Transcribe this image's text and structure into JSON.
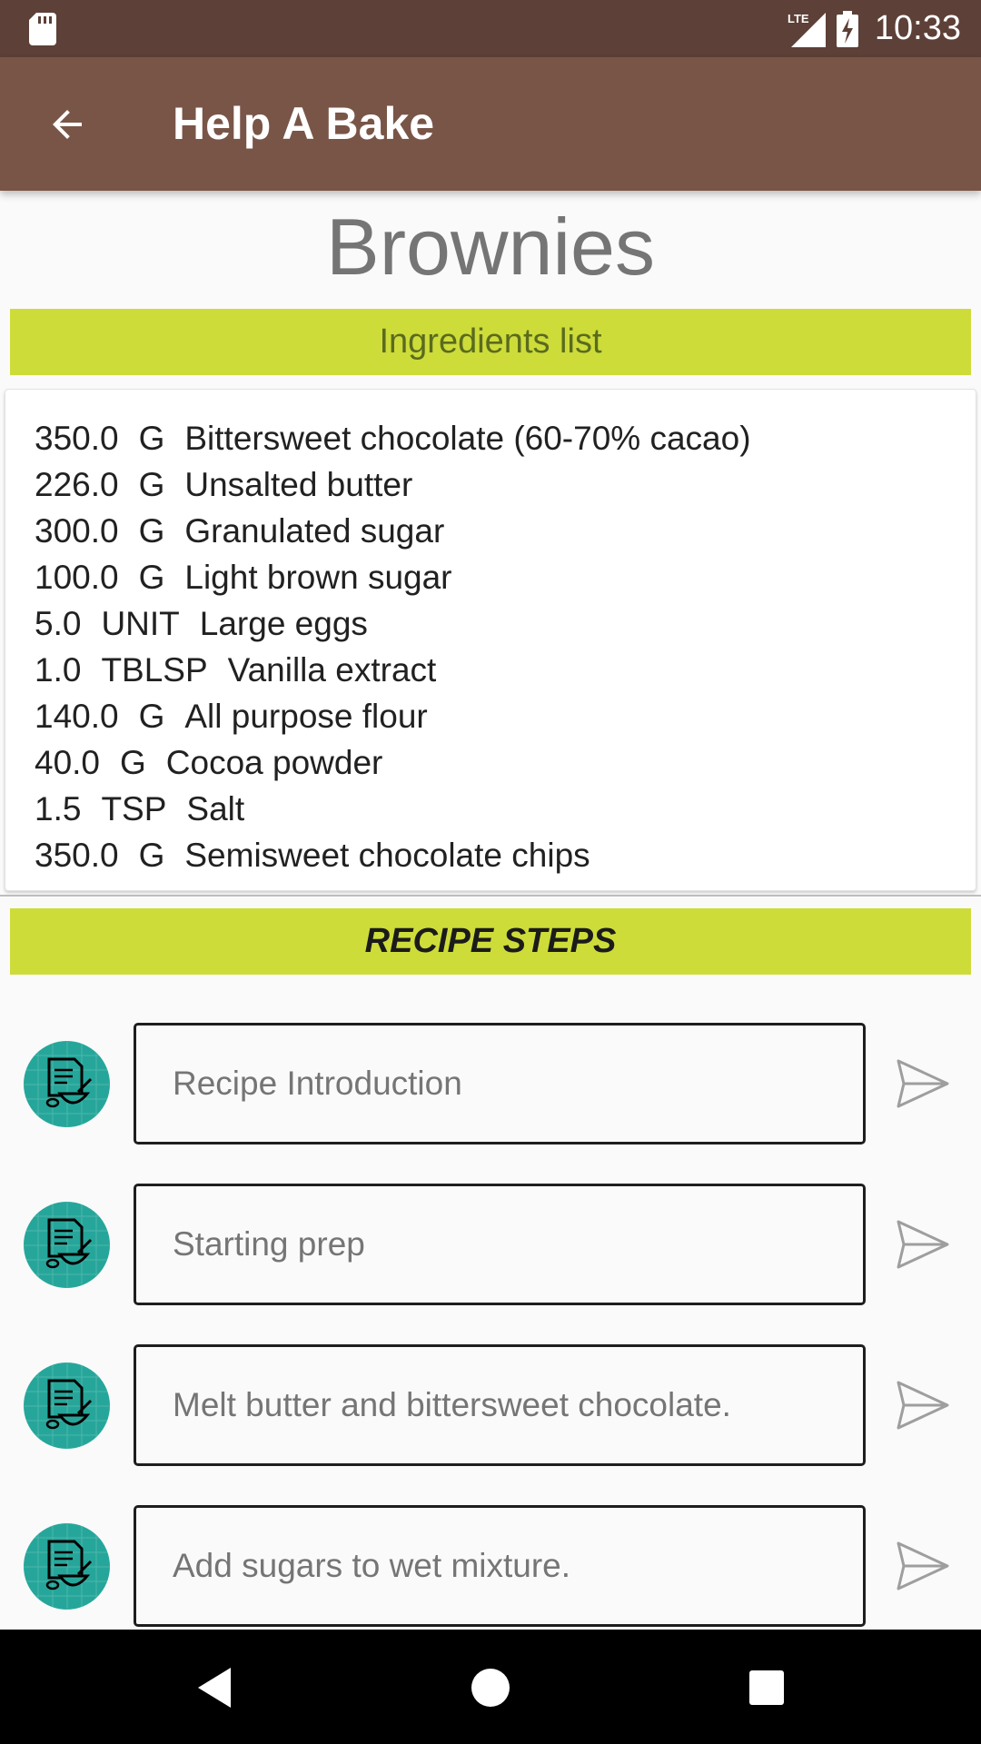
{
  "status_bar": {
    "time": "10:33",
    "network": "LTE",
    "icons": [
      "sd-card-icon",
      "signal-icon",
      "battery-charging-icon"
    ]
  },
  "app_bar": {
    "title": "Help A Bake",
    "back_icon": "arrow-back-icon"
  },
  "recipe": {
    "title": "Brownies",
    "ingredients_header": "Ingredients list",
    "steps_header": "RECIPE STEPS",
    "ingredients": [
      {
        "quantity": "350.0",
        "unit": "G",
        "name": "Bittersweet chocolate (60-70% cacao)"
      },
      {
        "quantity": "226.0",
        "unit": "G",
        "name": "Unsalted butter"
      },
      {
        "quantity": "300.0",
        "unit": "G",
        "name": "Granulated sugar"
      },
      {
        "quantity": "100.0",
        "unit": "G",
        "name": "Light brown sugar"
      },
      {
        "quantity": "5.0",
        "unit": "UNIT",
        "name": "Large eggs"
      },
      {
        "quantity": "1.0",
        "unit": "TBLSP",
        "name": "Vanilla extract"
      },
      {
        "quantity": "140.0",
        "unit": "G",
        "name": "All purpose flour"
      },
      {
        "quantity": "40.0",
        "unit": "G",
        "name": "Cocoa powder"
      },
      {
        "quantity": "1.5",
        "unit": "TSP",
        "name": "Salt"
      },
      {
        "quantity": "350.0",
        "unit": "G",
        "name": "Semisweet chocolate chips"
      }
    ],
    "steps": [
      {
        "label": "Recipe Introduction"
      },
      {
        "label": "Starting prep"
      },
      {
        "label": "Melt butter and bittersweet chocolate."
      },
      {
        "label": "Add sugars to wet mixture."
      }
    ]
  },
  "nav_bar": {
    "icons": [
      "nav-back-icon",
      "nav-home-icon",
      "nav-recents-icon"
    ]
  },
  "colors": {
    "status_bar": "#5d4037",
    "app_bar": "#795548",
    "section_header": "#cddc39",
    "step_avatar": "#26a69a"
  }
}
